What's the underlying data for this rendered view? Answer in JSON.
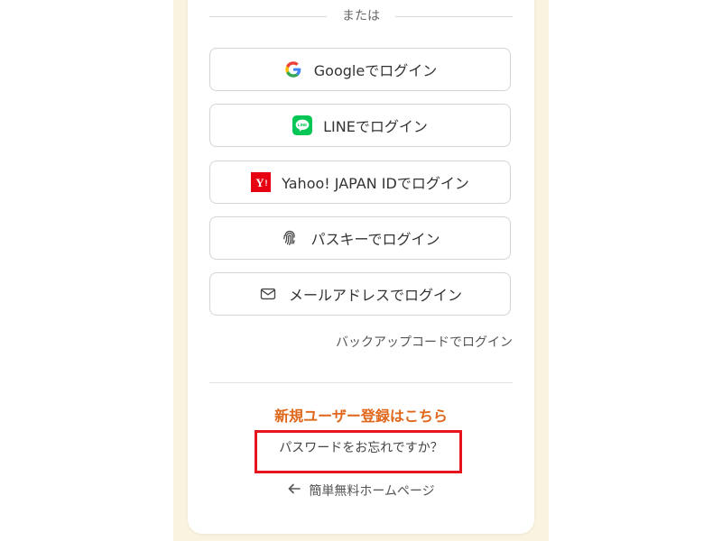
{
  "divider": {
    "text": "または"
  },
  "login_buttons": [
    {
      "label": "Googleでログイン",
      "icon": "google-icon"
    },
    {
      "label": "LINEでログイン",
      "icon": "line-icon"
    },
    {
      "label": "Yahoo! JAPAN IDでログイン",
      "icon": "yahoo-icon"
    },
    {
      "label": "パスキーでログイン",
      "icon": "fingerprint-icon"
    },
    {
      "label": "メールアドレスでログイン",
      "icon": "mail-icon"
    }
  ],
  "backup_link": "バックアップコードでログイン",
  "register_link": "新規ユーザー登録はこちら",
  "forgot_link": "パスワードをお忘れですか？",
  "home_link": "簡単無料ホームページ",
  "colors": {
    "accent_orange": "#e0661a",
    "highlight_red": "#e5141e",
    "line_green": "#06c755",
    "yahoo_red": "#e60012",
    "cream": "#faf3e0"
  }
}
